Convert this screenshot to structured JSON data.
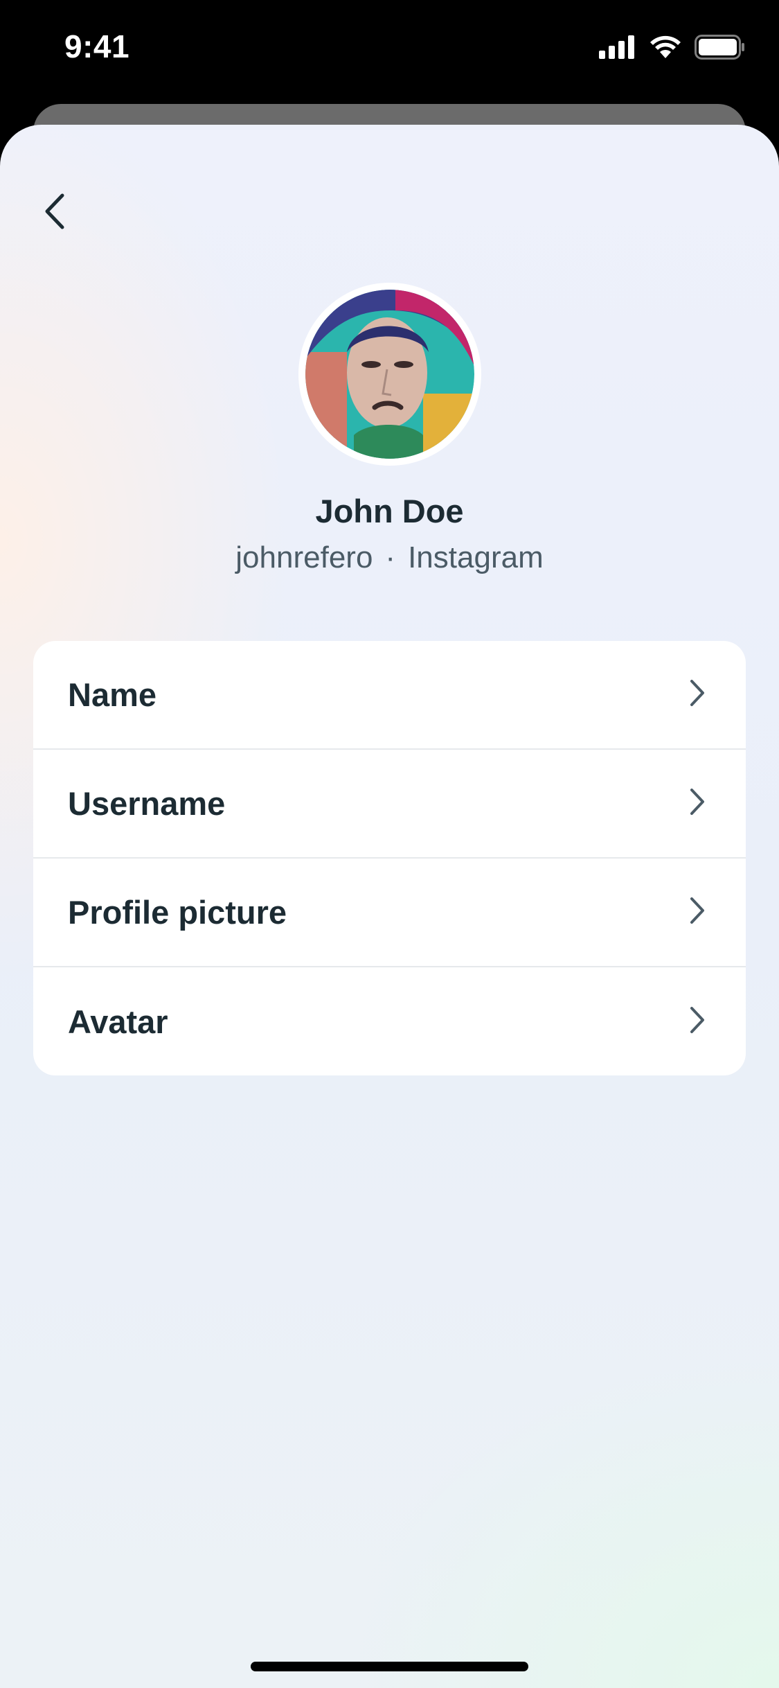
{
  "status_bar": {
    "time": "9:41"
  },
  "profile": {
    "name": "John Doe",
    "username": "johnrefero",
    "separator": "·",
    "platform": "Instagram"
  },
  "menu": {
    "items": [
      {
        "label": "Name"
      },
      {
        "label": "Username"
      },
      {
        "label": "Profile picture"
      },
      {
        "label": "Avatar"
      }
    ]
  },
  "icons": {
    "back": "chevron-left-icon",
    "row_arrow": "chevron-right-icon",
    "signal": "cellular-signal-icon",
    "wifi": "wifi-icon",
    "battery": "battery-icon"
  },
  "colors": {
    "text_primary": "#1c2b33",
    "text_secondary": "#4b5b66"
  }
}
